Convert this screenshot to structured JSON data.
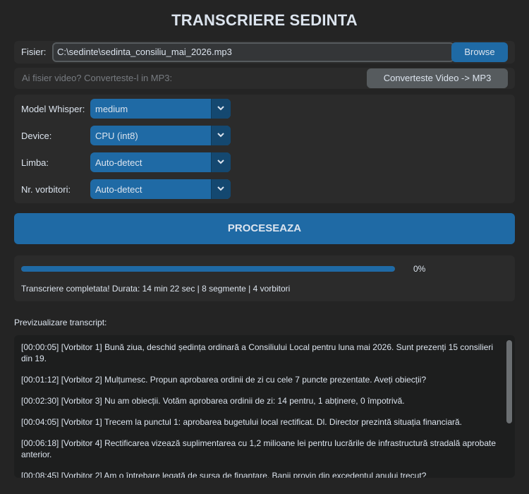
{
  "app": {
    "title": "TRANSCRIERE SEDINTA"
  },
  "file": {
    "label": "Fisier:",
    "path": "C:\\sedinte\\sedinta_consiliu_mai_2026.mp3",
    "browse_label": "Browse"
  },
  "convert": {
    "hint": "Ai fisier video? Converteste-l in MP3:",
    "button_label": "Converteste Video -> MP3"
  },
  "options": [
    {
      "label": "Model Whisper:",
      "value": "medium"
    },
    {
      "label": "Device:",
      "value": "CPU (int8)"
    },
    {
      "label": "Limba:",
      "value": "Auto-detect"
    },
    {
      "label": "Nr. vorbitori:",
      "value": "Auto-detect"
    }
  ],
  "process": {
    "label": "PROCESEAZA"
  },
  "progress": {
    "fraction": 1.0,
    "percent_text": "0%",
    "status": "Transcriere completata! Durata: 14 min 22 sec | 8 segmente | 4 vorbitori"
  },
  "preview": {
    "label": "Previzualizare transcript:",
    "segments": [
      "[00:00:05] [Vorbitor 1] Bună ziua, deschid ședința ordinară a Consiliului Local pentru luna mai 2026. Sunt prezenți 15 consilieri din 19.",
      "[00:01:12] [Vorbitor 2] Mulțumesc. Propun aprobarea ordinii de zi cu cele 7 puncte prezentate. Aveți obiecții?",
      "[00:02:30] [Vorbitor 3] Nu am obiecții. Votăm aprobarea ordinii de zi: 14 pentru, 1 abținere, 0 împotrivă.",
      "[00:04:05] [Vorbitor 1] Trecem la punctul 1: aprobarea bugetului local rectificat. Dl. Director prezintă situația financiară.",
      "[00:06:18] [Vorbitor 4] Rectificarea vizează suplimentarea cu 1,2 milioane lei pentru lucrările de infrastructură stradală aprobate anterior.",
      "[00:08:45] [Vorbitor 2] Am o întrebare legată de sursa de finanțare. Banii provin din excedentul anului trecut?"
    ]
  },
  "colors": {
    "background": "#242424",
    "panel": "#2b2b2b",
    "accent": "#1f6aa5",
    "accent_dark": "#144870",
    "secondary_button": "#565b5e"
  },
  "icons": {
    "dropdown": "chevron-down-icon"
  }
}
